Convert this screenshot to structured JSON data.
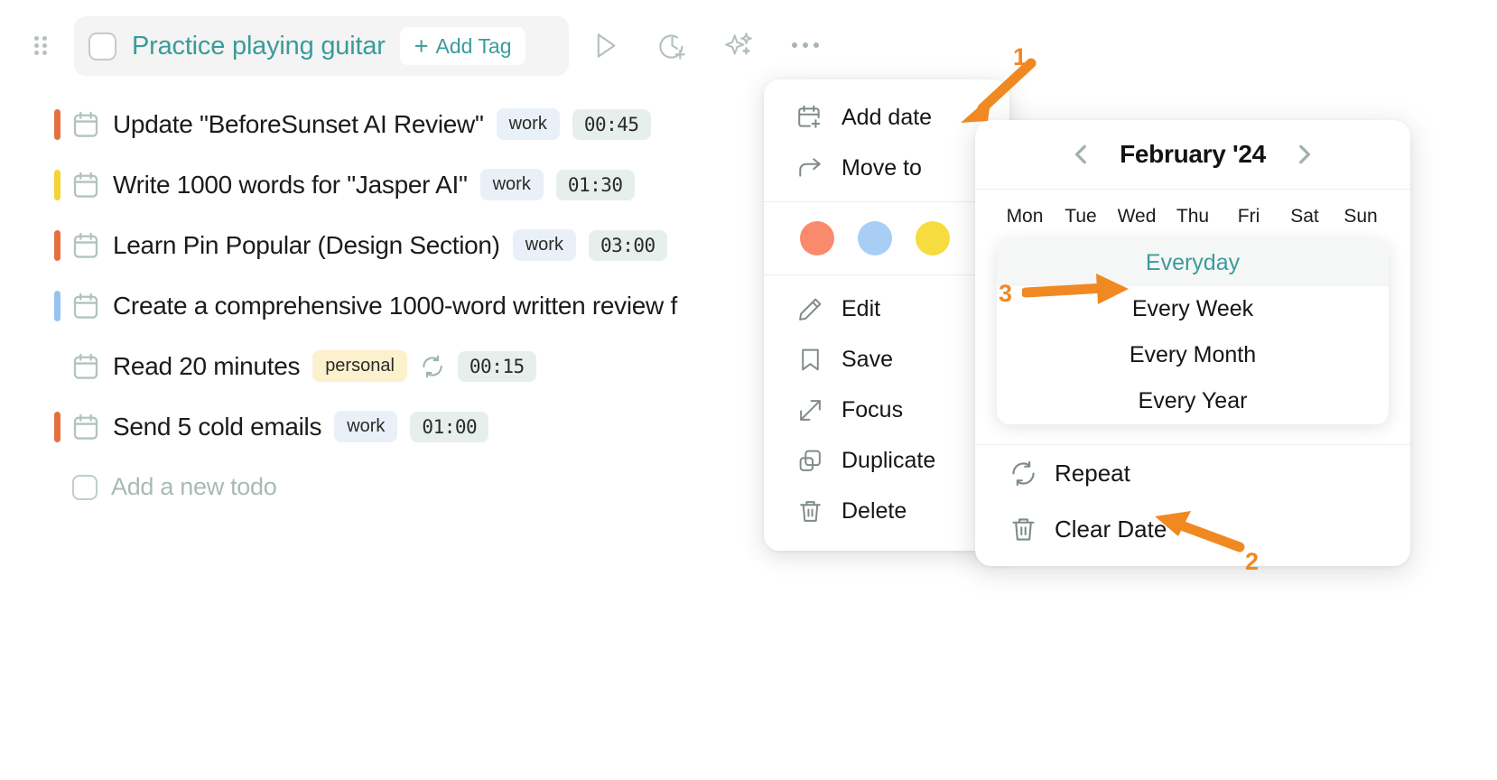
{
  "header": {
    "title": "Practice playing guitar",
    "add_tag_label": "Add Tag",
    "plus": "+",
    "icons": [
      "play-icon",
      "clock-plus-icon",
      "ai-sparkle-icon",
      "ellipsis-icon"
    ]
  },
  "todos": [
    {
      "title": "Update \"BeforeSunset AI Review\"",
      "tag": "work",
      "time": "00:45",
      "priority_color": "#e2713f",
      "repeat": false
    },
    {
      "title": "Write 1000 words for \"Jasper AI\"",
      "tag": "work",
      "time": "01:30",
      "priority_color": "#f5d335",
      "repeat": false
    },
    {
      "title": "Learn Pin Popular (Design Section)",
      "tag": "work",
      "time": "03:00",
      "priority_color": "#e2713f",
      "repeat": false
    },
    {
      "title": "Create a comprehensive 1000-word written review f",
      "tag": "",
      "time": "",
      "priority_color": "#93c4ef",
      "repeat": false
    },
    {
      "title": "Read 20 minutes",
      "tag": "personal",
      "time": "00:15",
      "priority_color": "",
      "repeat": true
    },
    {
      "title": "Send 5 cold emails",
      "tag": "work",
      "time": "01:00",
      "priority_color": "#e2713f",
      "repeat": false
    }
  ],
  "new_todo_placeholder": "Add a new todo",
  "context_menu": {
    "items_top": [
      {
        "label": "Add date",
        "icon": "calendar-plus-icon"
      },
      {
        "label": "Move to",
        "icon": "arrow-move-icon"
      }
    ],
    "swatches": [
      "#f98a6c",
      "#a8cef5",
      "#f6dc3f"
    ],
    "items_bottom": [
      {
        "label": "Edit",
        "icon": "pencil-icon"
      },
      {
        "label": "Save",
        "icon": "bookmark-icon"
      },
      {
        "label": "Focus",
        "icon": "expand-arrows-icon"
      },
      {
        "label": "Duplicate",
        "icon": "duplicate-icon"
      },
      {
        "label": "Delete",
        "icon": "trash-icon"
      }
    ]
  },
  "date_panel": {
    "month_title": "February '24",
    "prev_label": "previous-month",
    "next_label": "next-month",
    "weekdays": [
      "Mon",
      "Tue",
      "Wed",
      "Thu",
      "Fri",
      "Sat",
      "Sun"
    ],
    "repeat_options": [
      {
        "label": "Everyday",
        "selected": true
      },
      {
        "label": "Every Week",
        "selected": false
      },
      {
        "label": "Every Month",
        "selected": false
      },
      {
        "label": "Every Year",
        "selected": false
      }
    ],
    "footer": [
      {
        "label": "Repeat",
        "icon": "repeat-icon"
      },
      {
        "label": "Clear Date",
        "icon": "trash-icon"
      }
    ]
  },
  "annotations": [
    {
      "number": "1",
      "target": "Add date"
    },
    {
      "number": "2",
      "target": "Repeat"
    },
    {
      "number": "3",
      "target": "Everyday"
    }
  ],
  "colors": {
    "accent_teal": "#3b9b9b",
    "annotation_orange": "#f08922",
    "tag_work_bg": "#e9f0f7",
    "tag_personal_bg": "#fdf1cd",
    "time_chip_bg": "#e7efed"
  }
}
